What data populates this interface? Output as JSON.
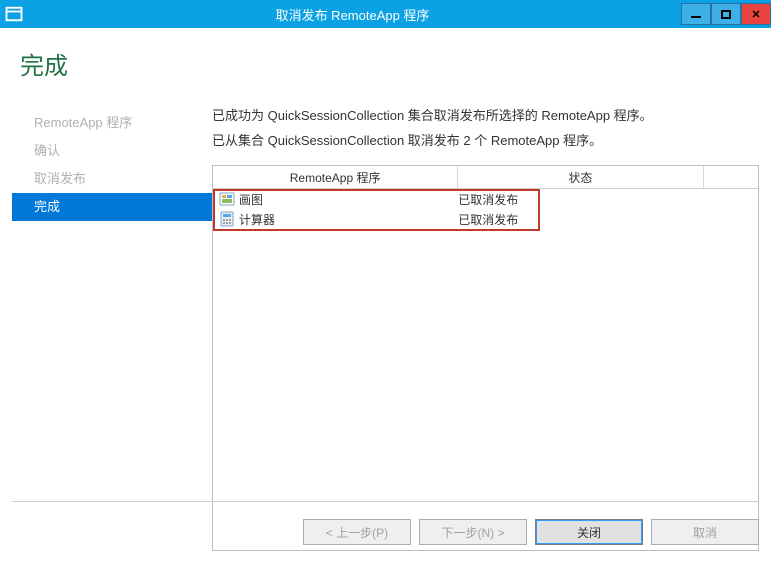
{
  "window": {
    "title": "取消发布 RemoteApp 程序"
  },
  "heading": "完成",
  "sidebar": {
    "items": [
      {
        "label": "RemoteApp 程序"
      },
      {
        "label": "确认"
      },
      {
        "label": "取消发布"
      },
      {
        "label": "完成"
      }
    ],
    "active_index": 3
  },
  "messages": {
    "line1": "已成功为 QuickSessionCollection 集合取消发布所选择的 RemoteApp 程序。",
    "line2": "已从集合 QuickSessionCollection 取消发布 2 个 RemoteApp 程序。"
  },
  "table": {
    "headers": {
      "c1": "RemoteApp 程序",
      "c2": "状态",
      "c3": ""
    },
    "rows": [
      {
        "icon": "paint-icon",
        "name": "画图",
        "status": "已取消发布"
      },
      {
        "icon": "calc-icon",
        "name": "计算器",
        "status": "已取消发布"
      }
    ]
  },
  "buttons": {
    "prev": "< 上一步(P)",
    "next": "下一步(N) >",
    "close": "关闭",
    "cancel": "取消"
  }
}
